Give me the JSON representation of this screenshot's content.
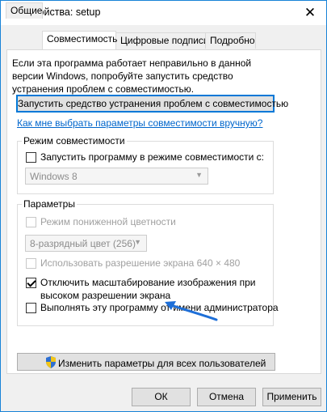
{
  "window": {
    "title": "Свойства: setup",
    "close_glyph": "✕"
  },
  "tabs": [
    {
      "label": "Общие",
      "active": false
    },
    {
      "label": "Совместимость",
      "active": true
    },
    {
      "label": "Цифровые подписи",
      "active": false
    },
    {
      "label": "Подробно",
      "active": false
    }
  ],
  "compat": {
    "description": "Если эта программа работает неправильно в данной версии Windows, попробуйте запустить средство устранения проблем с совместимостью.",
    "troubleshooter_button": "Запустить средство устранения проблем с совместимостью",
    "manual_link": "Как мне выбрать параметры совместимости вручную?",
    "mode_group": {
      "label": "Режим совместимости",
      "checkbox_label": "Запустить программу в режиме совместимости с:",
      "checked": false,
      "os_select_value": "Windows 8"
    },
    "params_group": {
      "label": "Параметры",
      "reduced_color_label": "Режим пониженной цветности",
      "color_select_value": "8-разрядный цвет (256)",
      "res640_label": "Использовать разрешение экрана 640 × 480",
      "dpi_label_line1": "Отключить масштабирование изображения при",
      "dpi_label_line2": "высоком разрешении экрана",
      "dpi_checked": true,
      "admin_label": "Выполнять эту программу от имени администратора",
      "admin_checked": false
    },
    "all_users_button": "Изменить параметры для всех пользователей"
  },
  "footer": {
    "ok": "ОК",
    "cancel": "Отмена",
    "apply": "Применить"
  },
  "colors": {
    "accent": "#0078d7",
    "link": "#0066cc",
    "annotation_arrow": "#1e6fd8"
  }
}
